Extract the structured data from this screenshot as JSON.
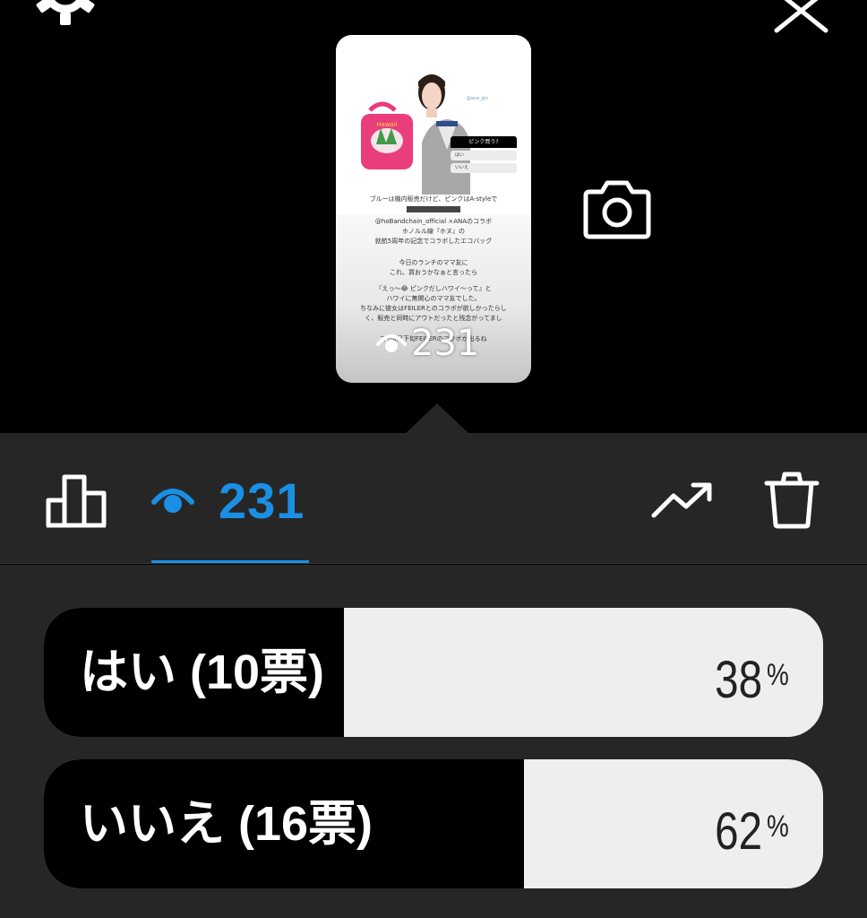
{
  "story": {
    "poll_question": "ピンク買う?",
    "poll_options": [
      "はい",
      "いいえ"
    ],
    "caption_lines": [
      "ブルーは機内販売だけど、ピンクはA-styleで",
      "@hoBandchain_official ×ANAのコラボ",
      "ホノルル線『ホヌ』の",
      "就航5周年の記念でコラボしたエコバッグ",
      "今日のランチのママ友に",
      "これ、買おうかなぁと言ったら",
      "『えっ〜😂 ピンクだしハワイ〜って』と",
      "ハワイに無関心のママ友でした。",
      "ちなみに彼女はFEILERとのコラボが欲しかったらし",
      "く、販売と同時にアウトだったと残念がってまし",
      "でも6月下旬FEILERのコラボが出るね"
    ],
    "views_overlay": "231"
  },
  "toolbar": {
    "icons": [
      "stats-icon",
      "eye-icon",
      "trending-icon",
      "trash-icon"
    ],
    "views_count": "231"
  },
  "colors": {
    "accent": "#1a8fe3",
    "panel": "#262626",
    "bar_fill": "#000000",
    "bar_track": "#eeeeee"
  },
  "poll_results": [
    {
      "label": "はい (10票)",
      "percent": "38",
      "fraction": 0.385,
      "sign": "%"
    },
    {
      "label": "いいえ (16票)",
      "percent": "62",
      "fraction": 0.616,
      "sign": "%"
    }
  ]
}
